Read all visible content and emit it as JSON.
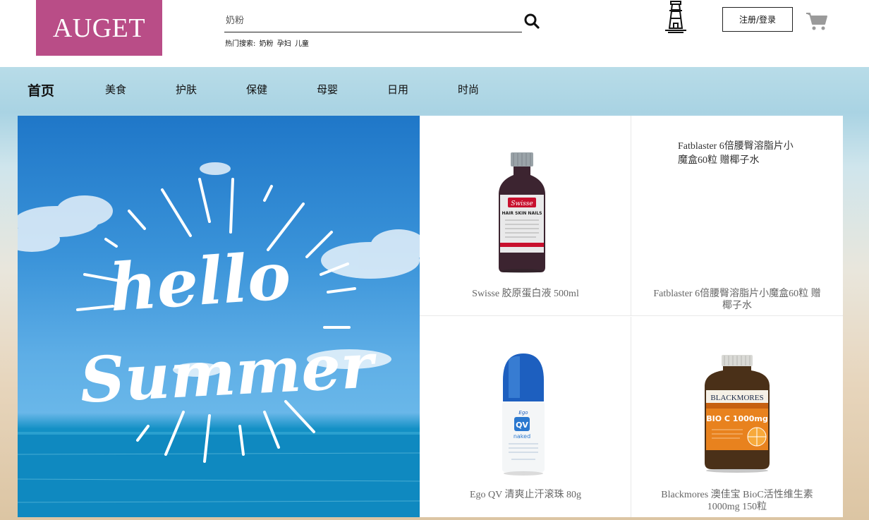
{
  "header": {
    "logo_text": "AUGET",
    "search_placeholder": "奶粉",
    "hot_label": "热门搜索:",
    "hot_terms": [
      "奶粉",
      "孕妇",
      "儿童"
    ],
    "login_label": "注册/登录"
  },
  "nav": {
    "items": [
      "首页",
      "美食",
      "护肤",
      "保健",
      "母婴",
      "日用",
      "时尚"
    ]
  },
  "banner": {
    "line1": "hello",
    "line2": "Summer"
  },
  "products": [
    {
      "name": "Swisse 胶原蛋白液 500ml",
      "label_brand": "Swisse",
      "label_sub": "HAIR SKIN NAILS"
    },
    {
      "name": "Fatblaster 6倍腰臀溶脂片小魔盒60粒 赠椰子水",
      "alt": "Fatblaster 6倍腰臀溶脂片小魔盒60粒 赠椰子水"
    },
    {
      "name": "Ego QV 清爽止汗滚珠 80g",
      "label_brand": "QV",
      "label_sub": "naked"
    },
    {
      "name": "Blackmores 澳佳宝 BioC活性维生素 1000mg 150粒",
      "label_brand": "BLACKMORES",
      "label_sub": "BIO C 1000mg"
    }
  ],
  "colors": {
    "logo_bg": "#b94d87",
    "accent_text": "#111111",
    "product_text": "#666666"
  }
}
